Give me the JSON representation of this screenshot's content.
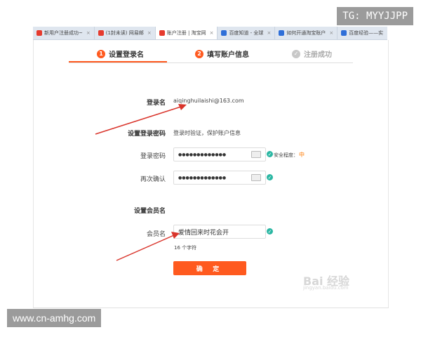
{
  "tabs": [
    {
      "label": "新用户注册成功~",
      "fav": "red"
    },
    {
      "label": "(1封未读) 网易邮",
      "fav": "red"
    },
    {
      "label": "账户注册 | 淘宝网",
      "fav": "red",
      "active": true
    },
    {
      "label": "百度知道 - 全球",
      "fav": "blue"
    },
    {
      "label": "如何开通淘宝账户",
      "fav": "blue"
    },
    {
      "label": "百度经验——实",
      "fav": "blue"
    }
  ],
  "close_glyph": "×",
  "steps": [
    {
      "num": "1",
      "label": "设置登录名"
    },
    {
      "num": "2",
      "label": "填写账户信息"
    },
    {
      "label": "注册成功"
    }
  ],
  "form": {
    "login_name_label": "登录名",
    "login_name_value": "aiqinghuilaishi@163.com",
    "set_password_label": "设置登录密码",
    "set_password_hint": "登录时验证，保护账户信息",
    "password_label": "登录密码",
    "password_value": "●●●●●●●●●●●●●",
    "strength_label": "安全程度：",
    "strength_mark": "中",
    "confirm_label": "再次确认",
    "confirm_value": "●●●●●●●●●●●●●",
    "member_section_label": "设置会员名",
    "member_label": "会员名",
    "member_value": "爱情回来时花会开",
    "char_count": "16 个字符",
    "submit_label": "确 定"
  },
  "watermarks": {
    "tg": "TG: MYYJJPP",
    "url": "www.cn-amhg.com",
    "baidu": "Bai 经验",
    "baidu_url": "jingyan.baidu.com"
  },
  "colors": {
    "accent": "#ff5a1f",
    "ok": "#2bb7a3",
    "arrow": "#d9342b"
  }
}
